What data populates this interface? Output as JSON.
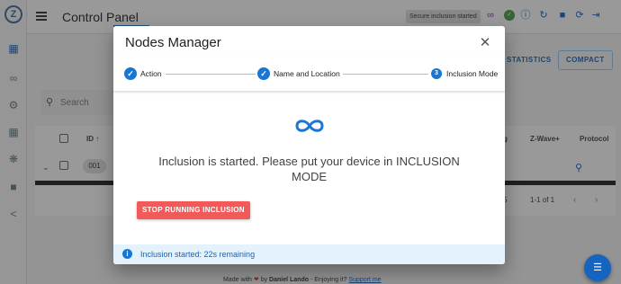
{
  "app": {
    "title": "Control Panel",
    "status_chip": "Secure inclusion started",
    "toolbar_icons": [
      "infinity-icon",
      "connection-icon",
      "info-icon",
      "history-icon",
      "lock-icon",
      "refresh-icon",
      "logout-icon"
    ],
    "sidebar_icons": [
      "dashboard-icon",
      "network-icon",
      "settings-icon",
      "scenes-icon",
      "debug-icon",
      "store-icon",
      "share-icon"
    ]
  },
  "background": {
    "statistics_label": "STATISTICS",
    "compact_label": "COMPACT",
    "search_placeholder": "Search",
    "table": {
      "headers": [
        "ID",
        "Z-Wave+",
        "Protocol"
      ],
      "header_cut": "g",
      "row_id": "001",
      "progress": 1.0,
      "pager_text": "1-1 of 1",
      "page_size": "5"
    },
    "footer": {
      "made_with": "Made with",
      "by": "by",
      "author": "Daniel Lando",
      "enjoying": "- Enjoying it?",
      "support": "Support me"
    }
  },
  "dialog": {
    "title": "Nodes Manager",
    "steps": [
      {
        "label": "Action",
        "state": "done"
      },
      {
        "label": "Name and Location",
        "state": "done"
      },
      {
        "label": "Inclusion Mode",
        "state": "active",
        "number": "3"
      }
    ],
    "message": "Inclusion is started. Please put your device in INCLUSION MODE",
    "stop_button": "STOP RUNNING INCLUSION",
    "alert": "Inclusion started: 22s remaining"
  },
  "colors": {
    "primary": "#1976d2",
    "stop_button": "#f25a5a",
    "alert_background": "#e3f2fd",
    "infinity_accent": "#8e24aa"
  }
}
